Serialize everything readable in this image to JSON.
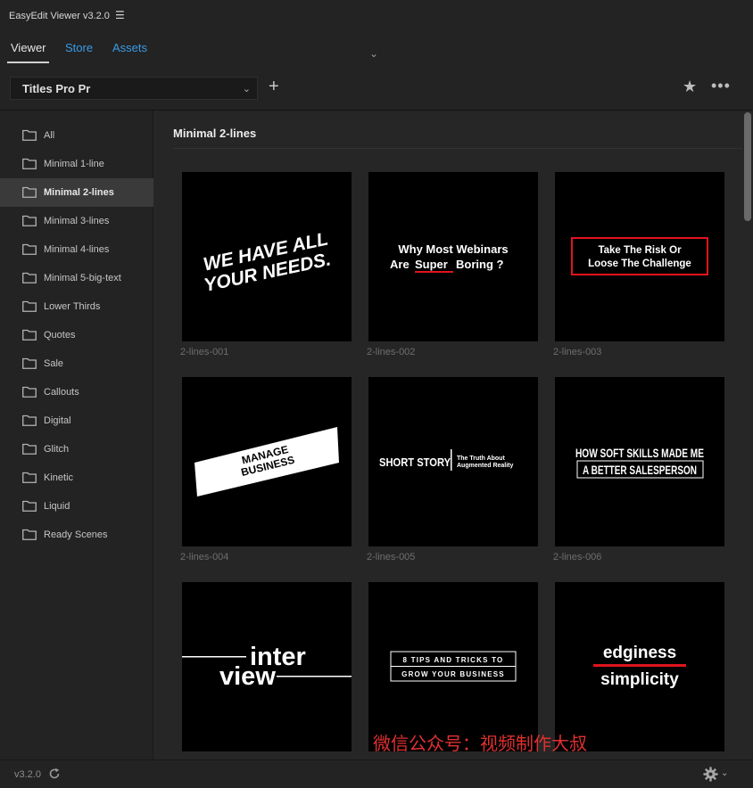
{
  "app": {
    "title": "EasyEdit Viewer v3.2.0"
  },
  "tabs": [
    {
      "label": "Viewer",
      "active": true
    },
    {
      "label": "Store",
      "active": false
    },
    {
      "label": "Assets",
      "active": false
    }
  ],
  "toolbar": {
    "selected_pack": "Titles Pro Pr"
  },
  "sidebar": {
    "items": [
      {
        "label": "All"
      },
      {
        "label": "Minimal 1-line"
      },
      {
        "label": "Minimal 2-lines",
        "active": true
      },
      {
        "label": "Minimal 3-lines"
      },
      {
        "label": "Minimal 4-lines"
      },
      {
        "label": "Minimal 5-big-text"
      },
      {
        "label": "Lower Thirds"
      },
      {
        "label": "Quotes"
      },
      {
        "label": "Sale"
      },
      {
        "label": "Callouts"
      },
      {
        "label": "Digital"
      },
      {
        "label": "Glitch"
      },
      {
        "label": "Kinetic"
      },
      {
        "label": "Liquid"
      },
      {
        "label": "Ready Scenes"
      }
    ]
  },
  "content": {
    "title": "Minimal 2-lines",
    "cards": [
      {
        "caption": "2-lines-001",
        "text": [
          "WE HAVE ALL",
          "YOUR NEEDS."
        ]
      },
      {
        "caption": "2-lines-002",
        "text": [
          "Why Most Webinars",
          "Are",
          "Super",
          "Boring ?"
        ]
      },
      {
        "caption": "2-lines-003",
        "text": [
          "Take The Risk Or",
          "Loose The Challenge"
        ]
      },
      {
        "caption": "2-lines-004",
        "text": [
          "MANAGE",
          "BUSINESS"
        ]
      },
      {
        "caption": "2-lines-005",
        "text": [
          "SHORT STORY",
          "The Truth About",
          "Augmented Reality"
        ]
      },
      {
        "caption": "2-lines-006",
        "text": [
          "HOW SOFT SKILLS MADE ME",
          "A BETTER SALESPERSON"
        ]
      },
      {
        "caption": "",
        "text": [
          "inter",
          "view"
        ]
      },
      {
        "caption": "",
        "text": [
          "8 TIPS AND TRICKS TO",
          "GROW YOUR BUSINESS"
        ]
      },
      {
        "caption": "",
        "text": [
          "edginess",
          "simplicity"
        ]
      }
    ]
  },
  "watermark": "微信公众号：视频制作大叔",
  "footer": {
    "version": "v3.2.0"
  },
  "colors": {
    "accent": "#3a9be6",
    "red": "#e0141e",
    "watermark": "#e0302f"
  },
  "icons": [
    "menu-icon",
    "chevron-down-icon",
    "plus-icon",
    "star-icon",
    "more-icon",
    "folder-icon",
    "refresh-icon",
    "gear-icon"
  ]
}
